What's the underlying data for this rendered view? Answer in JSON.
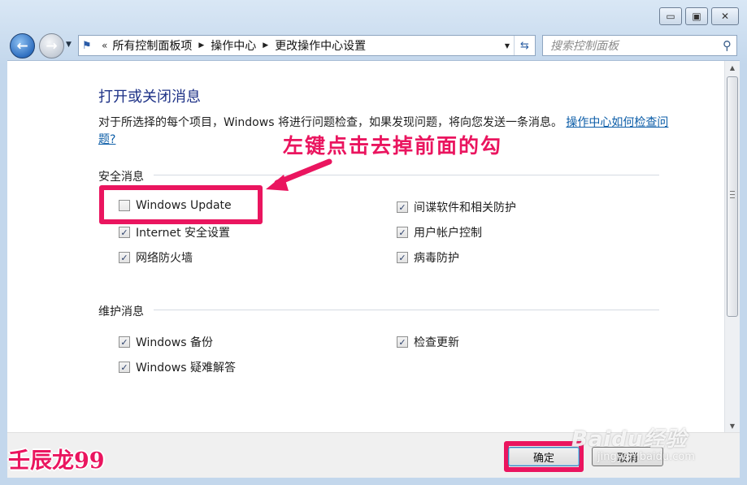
{
  "titlebar": {
    "minimize_glyph": "▭",
    "maximize_glyph": "▣",
    "close_glyph": "✕"
  },
  "nav": {
    "address_prefix": "«",
    "breadcrumbs": [
      "所有控制面板项",
      "操作中心",
      "更改操作中心设置"
    ],
    "separator_glyph": "▶",
    "search_placeholder": "搜索控制面板"
  },
  "content": {
    "heading": "打开或关闭消息",
    "description": "对于所选择的每个项目，Windows 将进行问题检查，如果发现问题，将向您发送一条消息。",
    "description_link": "操作中心如何检查问题?",
    "security_section": {
      "label": "安全消息",
      "items": [
        {
          "label": "Windows Update",
          "checked": false
        },
        {
          "label": "间谍软件和相关防护",
          "checked": true
        },
        {
          "label": "Internet 安全设置",
          "checked": true
        },
        {
          "label": "用户帐户控制",
          "checked": true
        },
        {
          "label": "网络防火墙",
          "checked": true
        },
        {
          "label": "病毒防护",
          "checked": true
        }
      ]
    },
    "maintenance_section": {
      "label": "维护消息",
      "items": [
        {
          "label": "Windows 备份",
          "checked": true
        },
        {
          "label": "检查更新",
          "checked": true
        },
        {
          "label": "Windows 疑难解答",
          "checked": true
        }
      ]
    }
  },
  "annotation": {
    "text": "左键点击去掉前面的勾",
    "color": "#ea155f"
  },
  "buttons": {
    "ok": "确定",
    "cancel": "取消"
  },
  "watermarks": {
    "signature": "壬辰龙99",
    "baidu": "Baidu经验",
    "baidu_sub": "jingyan.baidu.com"
  }
}
